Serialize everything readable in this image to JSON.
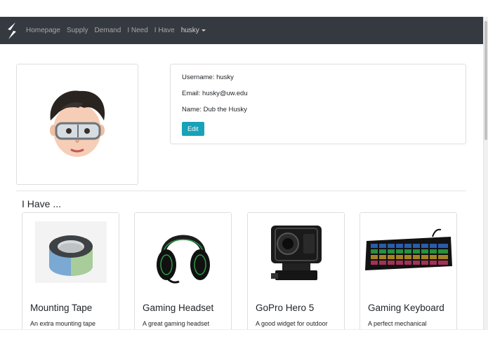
{
  "navbar": {
    "brand_icon": "s-logo-icon",
    "links": [
      "Homepage",
      "Supply",
      "Demand",
      "I Need",
      "I Have"
    ],
    "user_menu": "husky"
  },
  "profile": {
    "avatar_icon": "memoji-avatar-icon",
    "username": "Username: husky",
    "email": "Email: husky@uw.edu",
    "name": "Name: Dub the Husky",
    "edit_label": "Edit"
  },
  "section": {
    "title": "I Have ..."
  },
  "items": [
    {
      "title": "Mounting Tape",
      "text": "An extra mounting tape",
      "icon": "tape-roll-icon"
    },
    {
      "title": "Gaming Headset",
      "text": "A great gaming headset",
      "icon": "headset-icon"
    },
    {
      "title": "GoPro Hero 5",
      "text": "A good widget for outdoor",
      "icon": "action-camera-icon"
    },
    {
      "title": "Gaming Keyboard",
      "text": "A perfect mechanical",
      "icon": "keyboard-icon"
    }
  ],
  "colors": {
    "navbar": "#343a40",
    "accent": "#17a2b8"
  }
}
